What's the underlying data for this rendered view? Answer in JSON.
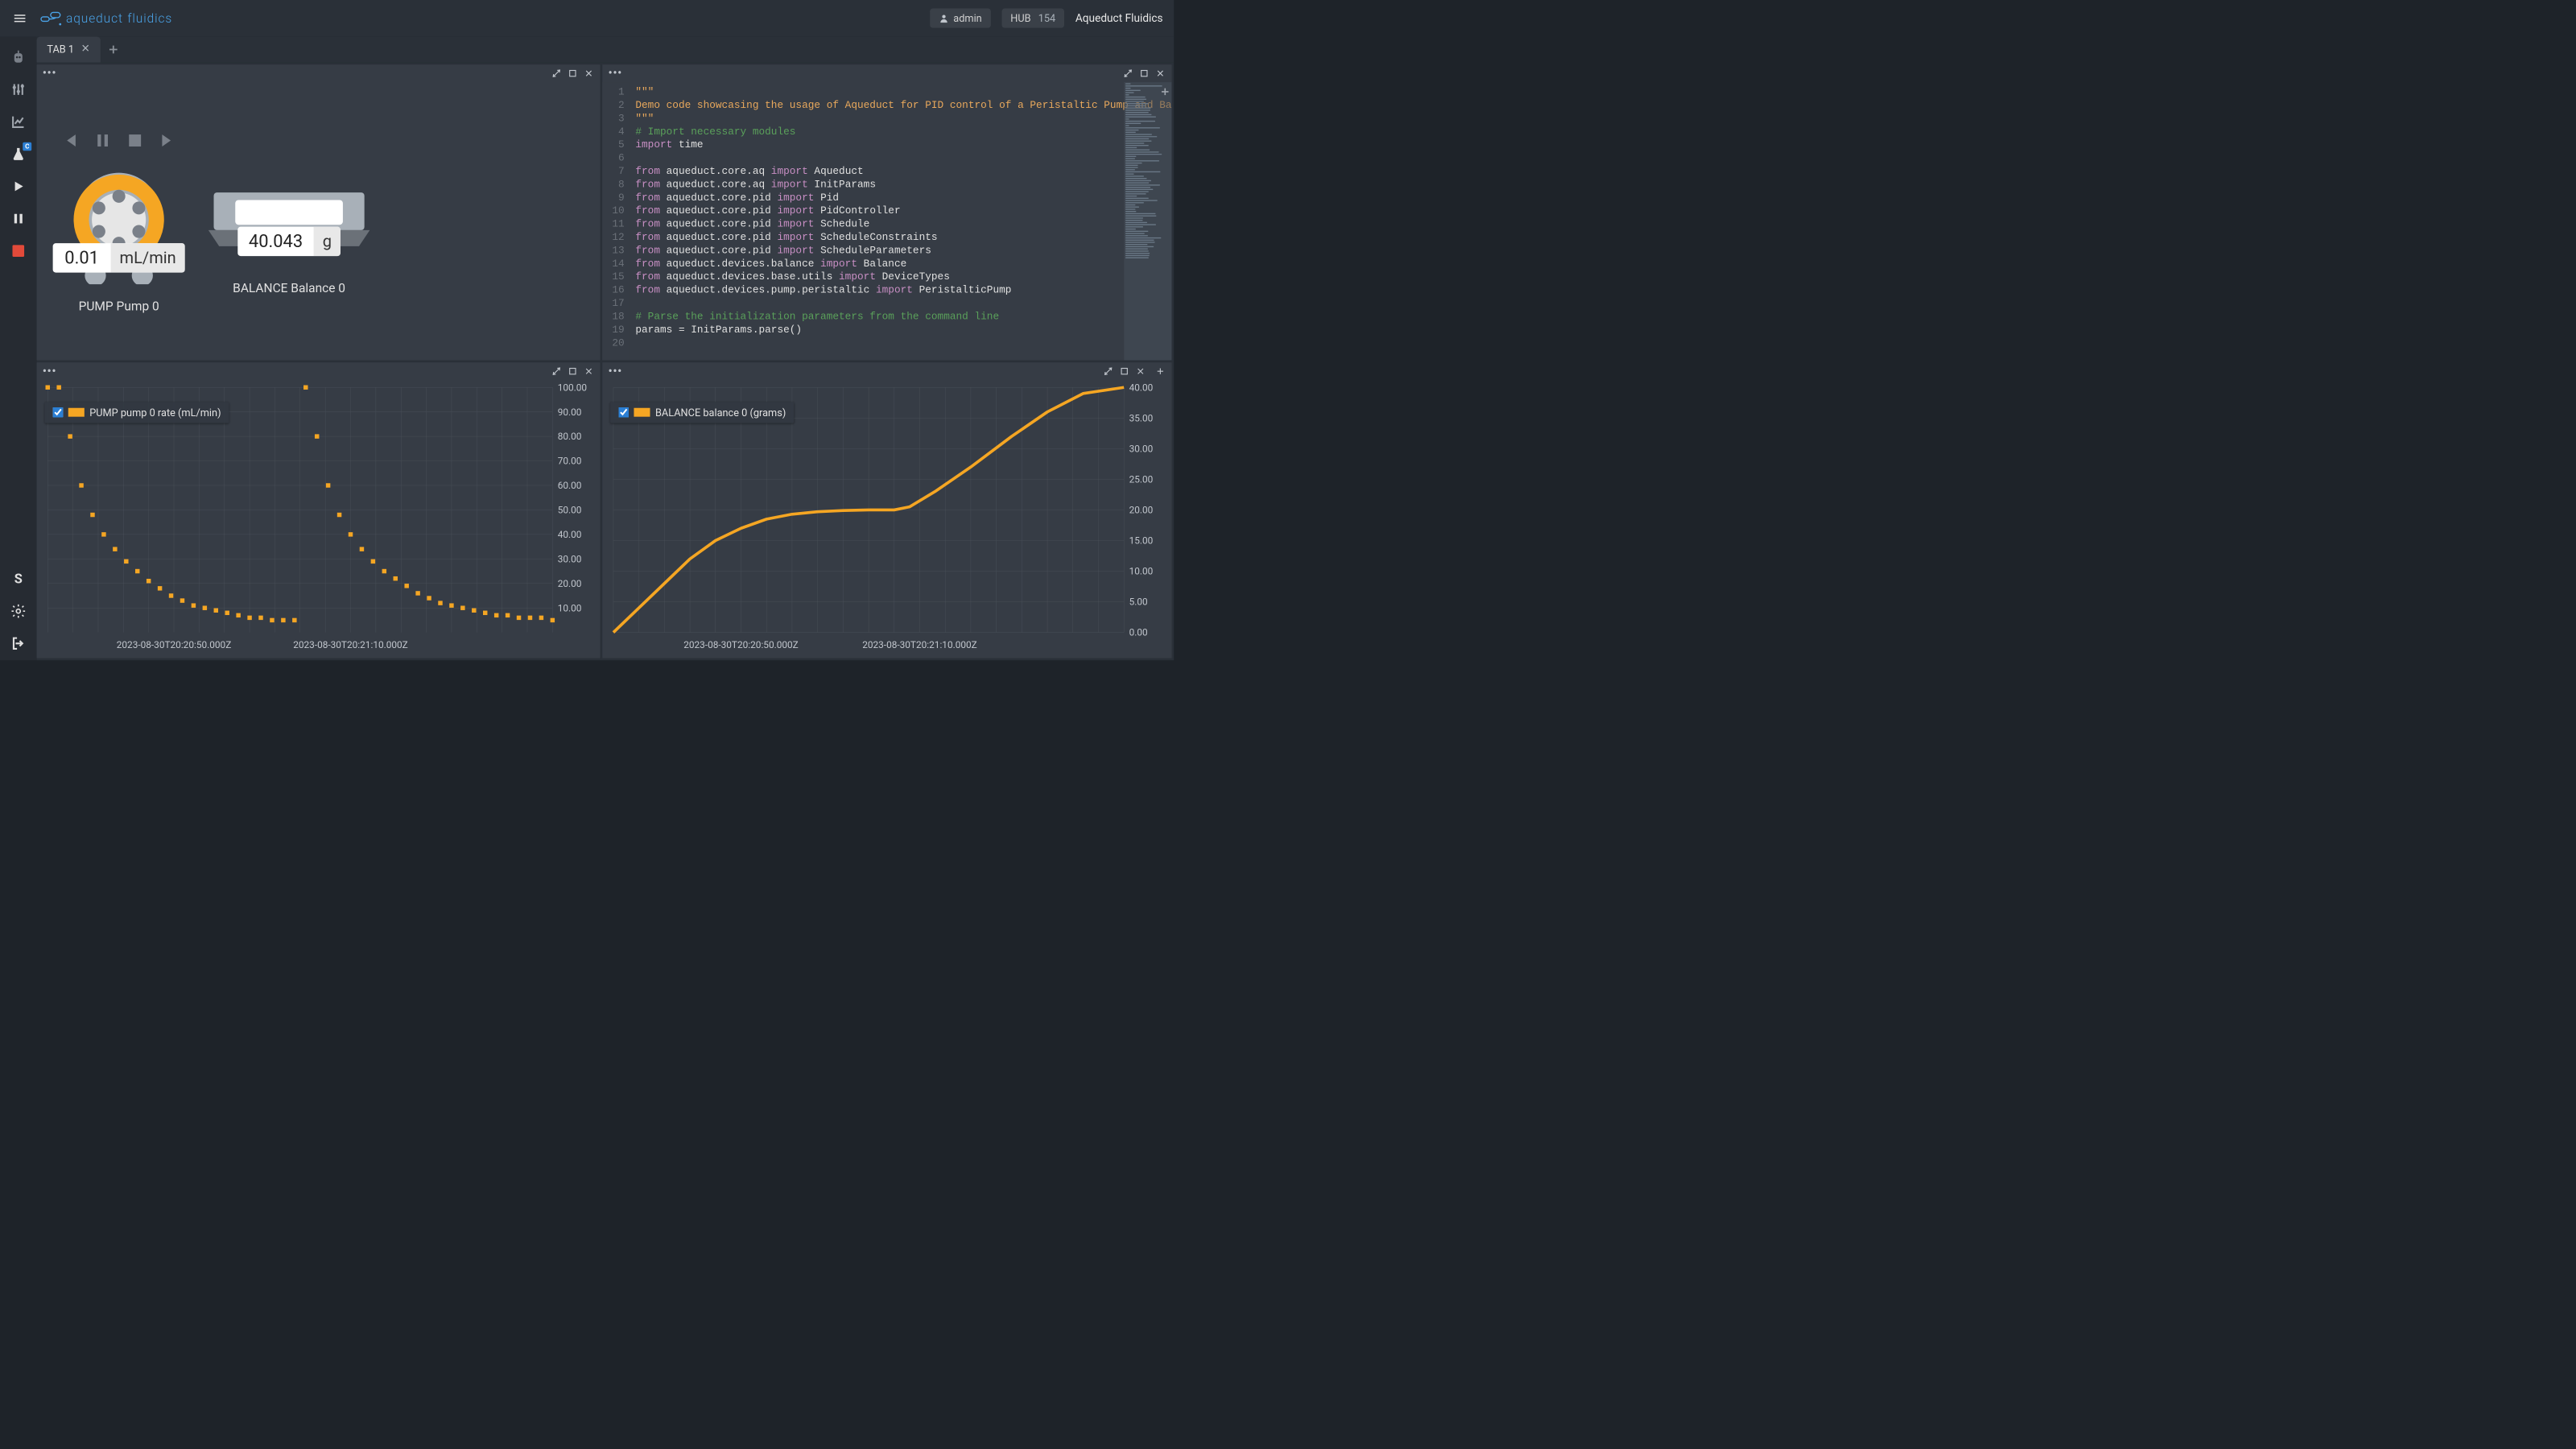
{
  "topbar": {
    "brand1": "aqueduct",
    "brand2": "fluidics",
    "user_icon": "user-avatar",
    "user_label": "admin",
    "hub_label": "HUB",
    "hub_num": "154",
    "brand_right": "Aqueduct Fluidics"
  },
  "sidebar": {
    "items": [
      {
        "name": "robot-icon"
      },
      {
        "name": "sliders-icon"
      },
      {
        "name": "chart-icon"
      },
      {
        "name": "flask-icon",
        "badge": "C"
      },
      {
        "name": "play-icon"
      },
      {
        "name": "pause-icon"
      },
      {
        "name": "stop-icon"
      }
    ],
    "bottom": [
      {
        "name": "s-icon",
        "label": "S"
      },
      {
        "name": "gear-icon"
      },
      {
        "name": "logout-icon"
      }
    ]
  },
  "tabs": {
    "items": [
      {
        "label": "TAB 1"
      }
    ]
  },
  "devices": {
    "pump": {
      "value": "0.01",
      "unit": "mL/min",
      "label": "PUMP Pump 0"
    },
    "balance": {
      "value": "40.043",
      "unit": "g",
      "label": "BALANCE Balance 0"
    }
  },
  "code": {
    "lines": [
      {
        "n": 1,
        "tokens": [
          {
            "t": "\"\"\"",
            "c": "str"
          }
        ]
      },
      {
        "n": 2,
        "tokens": [
          {
            "t": "Demo code showcasing the usage of Aqueduct for PID control of a Peristaltic Pump and Ba",
            "c": "str"
          }
        ]
      },
      {
        "n": 3,
        "tokens": [
          {
            "t": "\"\"\"",
            "c": "str"
          }
        ]
      },
      {
        "n": 4,
        "tokens": [
          {
            "t": "# Import necessary modules",
            "c": "cmt"
          }
        ]
      },
      {
        "n": 5,
        "tokens": [
          {
            "t": "import",
            "c": "kw"
          },
          {
            "t": " time",
            "c": "nm"
          }
        ]
      },
      {
        "n": 6,
        "tokens": []
      },
      {
        "n": 7,
        "tokens": [
          {
            "t": "from",
            "c": "kw"
          },
          {
            "t": " aqueduct.core.aq ",
            "c": "nm"
          },
          {
            "t": "import",
            "c": "kw"
          },
          {
            "t": " Aqueduct",
            "c": "nm"
          }
        ]
      },
      {
        "n": 8,
        "tokens": [
          {
            "t": "from",
            "c": "kw"
          },
          {
            "t": " aqueduct.core.aq ",
            "c": "nm"
          },
          {
            "t": "import",
            "c": "kw"
          },
          {
            "t": " InitParams",
            "c": "nm"
          }
        ]
      },
      {
        "n": 9,
        "tokens": [
          {
            "t": "from",
            "c": "kw"
          },
          {
            "t": " aqueduct.core.pid ",
            "c": "nm"
          },
          {
            "t": "import",
            "c": "kw"
          },
          {
            "t": " Pid",
            "c": "nm"
          }
        ]
      },
      {
        "n": 10,
        "tokens": [
          {
            "t": "from",
            "c": "kw"
          },
          {
            "t": " aqueduct.core.pid ",
            "c": "nm"
          },
          {
            "t": "import",
            "c": "kw"
          },
          {
            "t": " PidController",
            "c": "nm"
          }
        ]
      },
      {
        "n": 11,
        "tokens": [
          {
            "t": "from",
            "c": "kw"
          },
          {
            "t": " aqueduct.core.pid ",
            "c": "nm"
          },
          {
            "t": "import",
            "c": "kw"
          },
          {
            "t": " Schedule",
            "c": "nm"
          }
        ]
      },
      {
        "n": 12,
        "tokens": [
          {
            "t": "from",
            "c": "kw"
          },
          {
            "t": " aqueduct.core.pid ",
            "c": "nm"
          },
          {
            "t": "import",
            "c": "kw"
          },
          {
            "t": " ScheduleConstraints",
            "c": "nm"
          }
        ]
      },
      {
        "n": 13,
        "tokens": [
          {
            "t": "from",
            "c": "kw"
          },
          {
            "t": " aqueduct.core.pid ",
            "c": "nm"
          },
          {
            "t": "import",
            "c": "kw"
          },
          {
            "t": " ScheduleParameters",
            "c": "nm"
          }
        ]
      },
      {
        "n": 14,
        "tokens": [
          {
            "t": "from",
            "c": "kw"
          },
          {
            "t": " aqueduct.devices.balance ",
            "c": "nm"
          },
          {
            "t": "import",
            "c": "kw"
          },
          {
            "t": " Balance",
            "c": "nm"
          }
        ]
      },
      {
        "n": 15,
        "tokens": [
          {
            "t": "from",
            "c": "kw"
          },
          {
            "t": " aqueduct.devices.base.utils ",
            "c": "nm"
          },
          {
            "t": "import",
            "c": "kw"
          },
          {
            "t": " DeviceTypes",
            "c": "nm"
          }
        ]
      },
      {
        "n": 16,
        "tokens": [
          {
            "t": "from",
            "c": "kw"
          },
          {
            "t": " aqueduct.devices.pump.peristaltic ",
            "c": "nm"
          },
          {
            "t": "import",
            "c": "kw"
          },
          {
            "t": " PeristalticPump",
            "c": "nm"
          }
        ]
      },
      {
        "n": 17,
        "tokens": []
      },
      {
        "n": 18,
        "tokens": [
          {
            "t": "# Parse the initialization parameters from the command line",
            "c": "cmt"
          }
        ]
      },
      {
        "n": 19,
        "tokens": [
          {
            "t": "params = InitParams.parse()",
            "c": "nm"
          }
        ]
      },
      {
        "n": 20,
        "tokens": []
      }
    ]
  },
  "chart_data": [
    {
      "type": "scatter",
      "legend": "PUMP pump 0 rate (mL/min)",
      "color": "#f5a623",
      "ylim": [
        0,
        100
      ],
      "yticks": [
        10,
        20,
        30,
        40,
        50,
        60,
        70,
        80,
        90,
        100
      ],
      "xticks": [
        "2023-08-30T20:20:50.000Z",
        "2023-08-30T20:21:10.000Z"
      ],
      "x": [
        0,
        1,
        2,
        3,
        4,
        5,
        6,
        7,
        8,
        9,
        10,
        11,
        12,
        13,
        14,
        15,
        16,
        17,
        18,
        19,
        20,
        21,
        22,
        23,
        24,
        25,
        26,
        27,
        28,
        29,
        30,
        31,
        32,
        33,
        34,
        35,
        36,
        37,
        38,
        39,
        40,
        41,
        42,
        43,
        44,
        45
      ],
      "values": [
        100,
        100,
        80,
        60,
        48,
        40,
        34,
        29,
        25,
        21,
        18,
        15,
        13,
        11,
        10,
        9,
        8,
        7,
        6,
        6,
        5,
        5,
        5,
        100,
        80,
        60,
        48,
        40,
        34,
        29,
        25,
        22,
        19,
        16,
        14,
        12,
        11,
        10,
        9,
        8,
        7,
        7,
        6,
        6,
        6,
        5
      ]
    },
    {
      "type": "line",
      "legend": "BALANCE balance 0 (grams)",
      "color": "#f5a623",
      "ylim": [
        0,
        40
      ],
      "yticks": [
        0,
        5,
        10,
        15,
        20,
        25,
        30,
        35,
        40
      ],
      "xticks": [
        "2023-08-30T20:20:50.000Z",
        "2023-08-30T20:21:10.000Z"
      ],
      "x": [
        0,
        0.05,
        0.1,
        0.15,
        0.2,
        0.25,
        0.3,
        0.35,
        0.4,
        0.45,
        0.5,
        0.55,
        0.58,
        0.63,
        0.7,
        0.78,
        0.85,
        0.92,
        1.0
      ],
      "values": [
        0,
        4,
        8,
        12,
        15,
        17,
        18.5,
        19.3,
        19.7,
        19.9,
        20,
        20,
        20.5,
        23,
        27,
        32,
        36,
        39,
        40
      ]
    }
  ]
}
